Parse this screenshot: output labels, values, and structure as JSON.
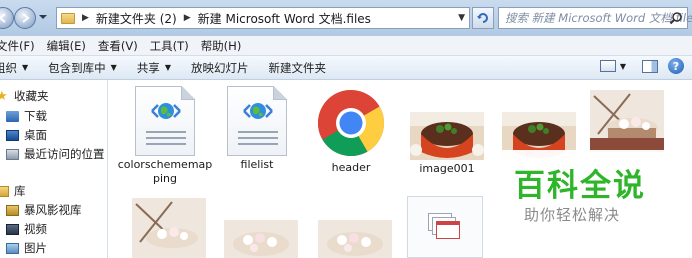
{
  "address_bar": {
    "crumbs": [
      "新建文件夹 (2)",
      "新建 Microsoft Word 文档.files"
    ],
    "search_placeholder": "搜索 新建 Microsoft Word 文档.files"
  },
  "menu": [
    "文件(F)",
    "编辑(E)",
    "查看(V)",
    "工具(T)",
    "帮助(H)"
  ],
  "commands": {
    "organize": "组织",
    "include_in_library": "包含到库中",
    "share": "共享",
    "slideshow": "放映幻灯片",
    "new_folder": "新建文件夹"
  },
  "nav": {
    "favorites": "收藏夹",
    "downloads": "下载",
    "desktop": "桌面",
    "recent": "最近访问的位置",
    "libraries": "库",
    "storm": "暴风影视库",
    "videos": "视频",
    "pictures": "图片"
  },
  "files": [
    {
      "label": "colorschememapping",
      "icon": "html-doc-icon"
    },
    {
      "label": "filelist",
      "icon": "html-doc-icon"
    },
    {
      "label": "header",
      "icon": "chrome-icon"
    },
    {
      "label": "image001",
      "icon": "photo-thumbnail"
    },
    {
      "label": "",
      "icon": "photo-thumbnail"
    },
    {
      "label": "",
      "icon": "photo-thumbnail"
    }
  ],
  "watermark": {
    "title": "百科全说",
    "subtitle": "助你轻松解决"
  },
  "colors": {
    "chrome_title": "#c9dbee",
    "watermark_green": "#2fb52a"
  }
}
